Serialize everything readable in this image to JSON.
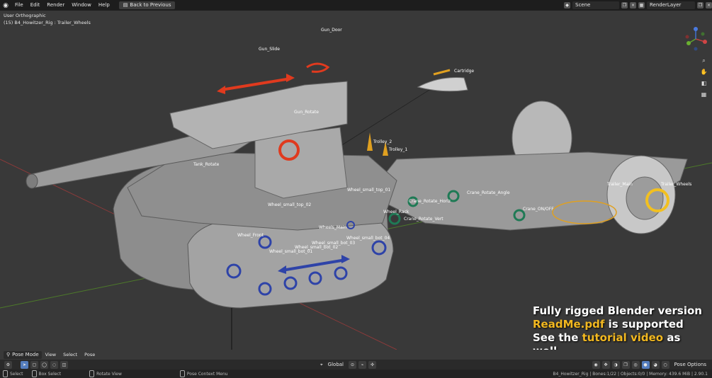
{
  "topbar": {
    "menu": [
      "File",
      "Edit",
      "Render",
      "Window",
      "Help"
    ],
    "back_button": "Back to Previous",
    "scene": "Scene",
    "render_layer": "RenderLayer"
  },
  "viewport": {
    "view_name": "User Orthographic",
    "object_info": "(15) B4_Howitzer_Rig : Trailer_Wheels",
    "bone_labels": [
      "Gun_Door",
      "Gun_Slide",
      "Cartridge",
      "Gun_Rotate",
      "Trolley_2",
      "Trolley_1",
      "Tank_Rotate",
      "Wheel_small_top_01",
      "Crane_Rotate_Angle",
      "Trailer_Main",
      "Trailer_Wheels",
      "Crane_Rotate_Horiz",
      "Wheel_small_top_02",
      "Crane_ON/OFF",
      "Wheel_Rack",
      "Crane_Rotate_Vert",
      "Wheels_Main",
      "Wheel_Front",
      "Wheel_small_bot_04",
      "Wheel_small_bot_03",
      "Wheel_small_bot_02",
      "Wheel_small_bot_01"
    ]
  },
  "promo": {
    "line1": "Fully rigged Blender version",
    "line2_highlight": "ReadMe.pdf",
    "line2_rest": " is supported",
    "line3_a": "See the ",
    "line3_highlight": "tutorial video",
    "line3_b": " as well."
  },
  "header": {
    "mode": "Pose Mode",
    "menus": [
      "View",
      "Select",
      "Pose"
    ],
    "orientation": "Global",
    "pose_options": "Pose Options"
  },
  "statusbar": {
    "select": "Select",
    "box_select": "Box Select",
    "rotate_view": "Rotate View",
    "context_menu": "Pose Context Menu",
    "stats": "B4_Howitzer_Rig | Bones:1/22 | Objects:0/0 | Memory: 439.6 MiB | 2.90.1"
  },
  "colors": {
    "bg": "#393939",
    "accent": "#f2b820",
    "red_control": "#e03a1e",
    "blue_control": "#2e43a8",
    "green_control": "#1f7a55"
  }
}
